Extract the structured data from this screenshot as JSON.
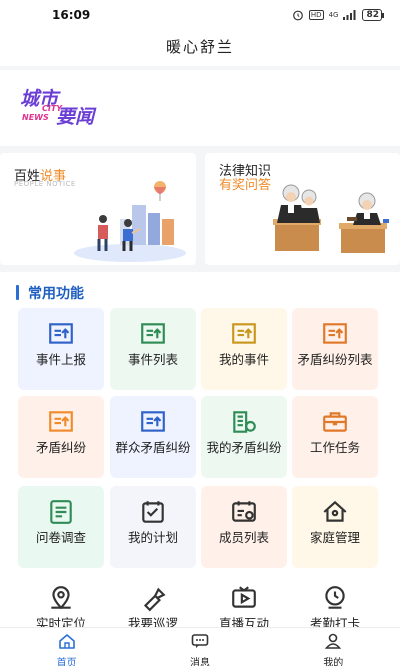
{
  "status_bar": {
    "time": "16:09",
    "network": "4G",
    "battery": "82"
  },
  "header": {
    "title": "暖心舒兰"
  },
  "banner": {
    "line1": "城市",
    "line2": "要闻",
    "en1": "CITY",
    "en2": "NEWS"
  },
  "cards": {
    "left": {
      "title_a": "百姓",
      "title_b": "说事",
      "subtitle": "PEOPLE NOTICE"
    },
    "right": {
      "title_a": "法律知识",
      "title_b": "有奖问答"
    }
  },
  "functions": {
    "title": "常用功能",
    "items": [
      {
        "label": "事件上报",
        "icon": "report-upload-icon",
        "color": "#2f62c8",
        "bg": "#eef3ff"
      },
      {
        "label": "事件列表",
        "icon": "list-upload-icon",
        "color": "#2f8c56",
        "bg": "#edf8f0"
      },
      {
        "label": "我的事件",
        "icon": "my-event-icon",
        "color": "#c9961e",
        "bg": "#fff8e8"
      },
      {
        "label": "矛盾纠纷列表",
        "icon": "dispute-list-icon",
        "color": "#e0782a",
        "bg": "#fff1e9"
      },
      {
        "label": "矛盾纠纷",
        "icon": "dispute-icon",
        "color": "#f08b2a",
        "bg": "#fff1e9"
      },
      {
        "label": "群众矛盾纠纷",
        "icon": "public-dispute-icon",
        "color": "#2f62c8",
        "bg": "#eef3ff"
      },
      {
        "label": "我的矛盾纠纷",
        "icon": "building-icon",
        "color": "#2f8c56",
        "bg": "#edf8f0"
      },
      {
        "label": "工作任务",
        "icon": "briefcase-icon",
        "color": "#e0782a",
        "bg": "#fff1e9"
      },
      {
        "label": "问卷调查",
        "icon": "survey-icon",
        "color": "#2f8c56",
        "bg": "#eaf8f2"
      },
      {
        "label": "我的计划",
        "icon": "plan-icon",
        "color": "#333333",
        "bg": "#f3f5fb"
      },
      {
        "label": "成员列表",
        "icon": "member-list-icon",
        "color": "#333333",
        "bg": "#fff1e9"
      },
      {
        "label": "家庭管理",
        "icon": "home-icon",
        "color": "#333333",
        "bg": "#fff8e8"
      },
      {
        "label": "实时定位",
        "icon": "location-icon",
        "color": "#333333",
        "bg": "#ffffff"
      },
      {
        "label": "我要巡逻",
        "icon": "flashlight-icon",
        "color": "#333333",
        "bg": "#ffffff"
      },
      {
        "label": "直播互动",
        "icon": "live-tv-icon",
        "color": "#333333",
        "bg": "#ffffff"
      },
      {
        "label": "考勤打卡",
        "icon": "clock-in-icon",
        "color": "#333333",
        "bg": "#ffffff"
      }
    ]
  },
  "tabbar": {
    "active": 0,
    "items": [
      {
        "label": "首页",
        "icon": "home-tab-icon"
      },
      {
        "label": "消息",
        "icon": "message-icon"
      },
      {
        "label": "我的",
        "icon": "profile-icon"
      }
    ]
  }
}
